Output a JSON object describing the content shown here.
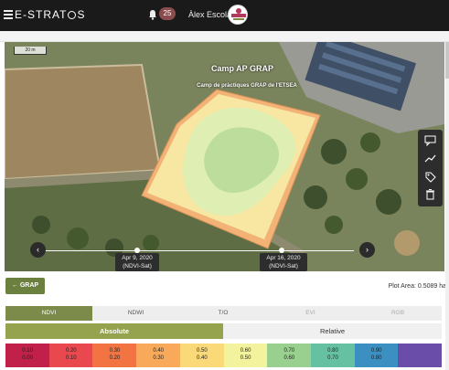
{
  "app": {
    "logo_text": "E-STRAT",
    "logo_suffix": "S",
    "notifications_count": "25",
    "user_name": "Àlex Escolà"
  },
  "map": {
    "title": "Camp AP GRAP",
    "subtitle": "Camp de pràctiques GRAP de l'ETSEA",
    "scale_label": "20 m",
    "tools": [
      "comment-icon",
      "chart-line-icon",
      "tag-icon",
      "trash-icon"
    ],
    "timeline": {
      "prev_label": "‹",
      "next_label": "›",
      "dates": [
        {
          "date": "Apr 9, 2020",
          "source": "(NDVI-Sat)"
        },
        {
          "date": "Apr 16, 2020",
          "source": "(NDVI-Sat)"
        }
      ]
    }
  },
  "controls": {
    "back_button_label": "← GRAP",
    "plot_area_label": "Plot Area: 0.5089 ha",
    "tabs": [
      {
        "label": "NDVI",
        "state": "active"
      },
      {
        "label": "NDWI",
        "state": "normal"
      },
      {
        "label": "T/O",
        "state": "normal"
      },
      {
        "label": "EVI",
        "state": "disabled"
      },
      {
        "label": "RGB",
        "state": "disabled"
      }
    ],
    "modes": [
      {
        "label": "Absolute",
        "state": "active"
      },
      {
        "label": "Relative",
        "state": "normal"
      }
    ]
  },
  "legend": {
    "bins": [
      {
        "top": "0.10",
        "bottom": "0.00",
        "color": "#c0204a"
      },
      {
        "top": "0.20",
        "bottom": "0.10",
        "color": "#e8484e"
      },
      {
        "top": "0.30",
        "bottom": "0.20",
        "color": "#f27443"
      },
      {
        "top": "0.40",
        "bottom": "0.30",
        "color": "#f8a95a"
      },
      {
        "top": "0.50",
        "bottom": "0.40",
        "color": "#fad979"
      },
      {
        "top": "0.60",
        "bottom": "0.50",
        "color": "#f2f39c"
      },
      {
        "top": "0.70",
        "bottom": "0.60",
        "color": "#9ad08f"
      },
      {
        "top": "0.80",
        "bottom": "0.70",
        "color": "#66c1a3"
      },
      {
        "top": "0.90",
        "bottom": "0.80",
        "color": "#3b8fc1"
      },
      {
        "top": "",
        "bottom": "",
        "color": "#6a4ca9"
      }
    ]
  }
}
